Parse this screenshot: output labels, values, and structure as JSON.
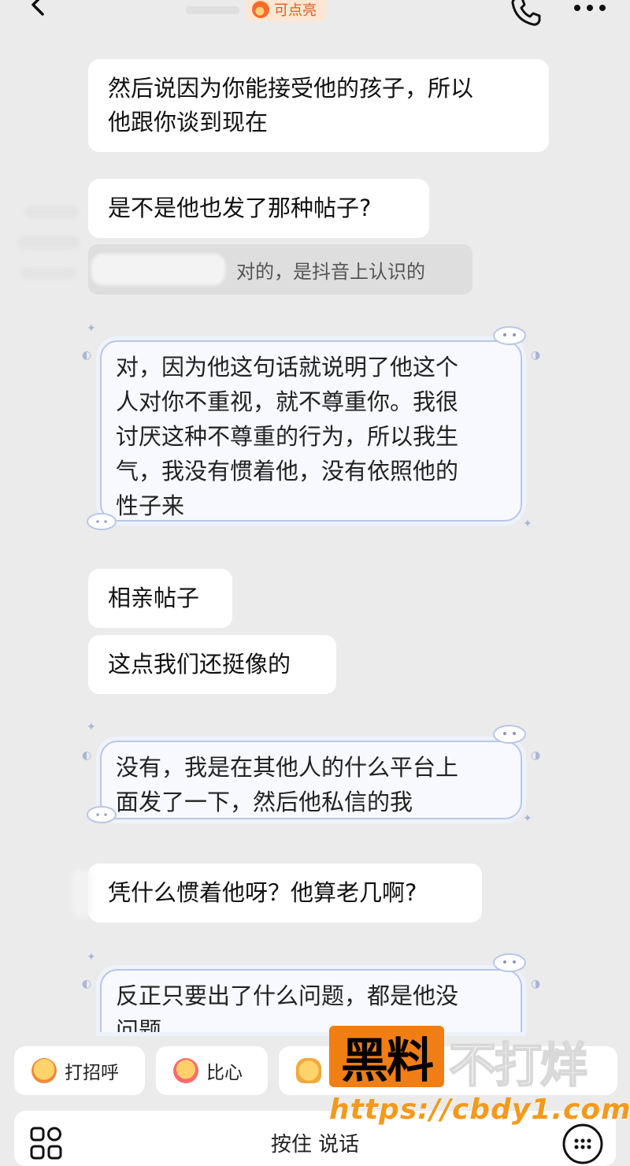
{
  "header": {
    "spark_label": "可点亮",
    "icons": {
      "back": "back-arrow-icon",
      "phone": "phone-icon",
      "more": "more-dots-icon",
      "fire": "fire-icon"
    }
  },
  "messages": [
    {
      "type": "received",
      "text_lines": [
        "然后说因为你能接受他的孩子，所以",
        "他跟你谈到现在"
      ]
    },
    {
      "type": "received",
      "text": "是不是他也发了那种帖子?"
    },
    {
      "type": "quoted-reply",
      "text": "对的，是抖音上认识的"
    },
    {
      "type": "sent",
      "text_lines": [
        "对，因为他这句话就说明了他这个",
        "人对你不重视，就不尊重你。我很",
        "讨厌这种不尊重的行为，所以我生",
        "气，我没有惯着他，没有依照他的",
        "性子来"
      ]
    },
    {
      "type": "received",
      "text": "相亲帖子"
    },
    {
      "type": "received",
      "text": "这点我们还挺像的"
    },
    {
      "type": "sent",
      "text_lines": [
        "没有，我是在其他人的什么平台上",
        "面发了一下，然后他私信的我"
      ]
    },
    {
      "type": "received",
      "text": "凭什么惯着他呀？他算老几啊?"
    },
    {
      "type": "sent",
      "text_lines": [
        "反正只要出了什么问题，都是他没",
        "问题"
      ]
    }
  ],
  "quick_actions": [
    {
      "label": "打招呼",
      "icon": "wave-hand-icon"
    },
    {
      "label": "比心",
      "icon": "heart-hand-icon"
    },
    {
      "label": "",
      "icon": "thumbs-up-icon"
    }
  ],
  "watermark": {
    "box_text": "黑料",
    "text": "不打烊",
    "url": "https://cbdy1.com"
  },
  "input_bar": {
    "voice_label": "按住 说话",
    "icons": {
      "apps": "apps-grid-icon",
      "keyboard": "keyboard-icon"
    }
  }
}
